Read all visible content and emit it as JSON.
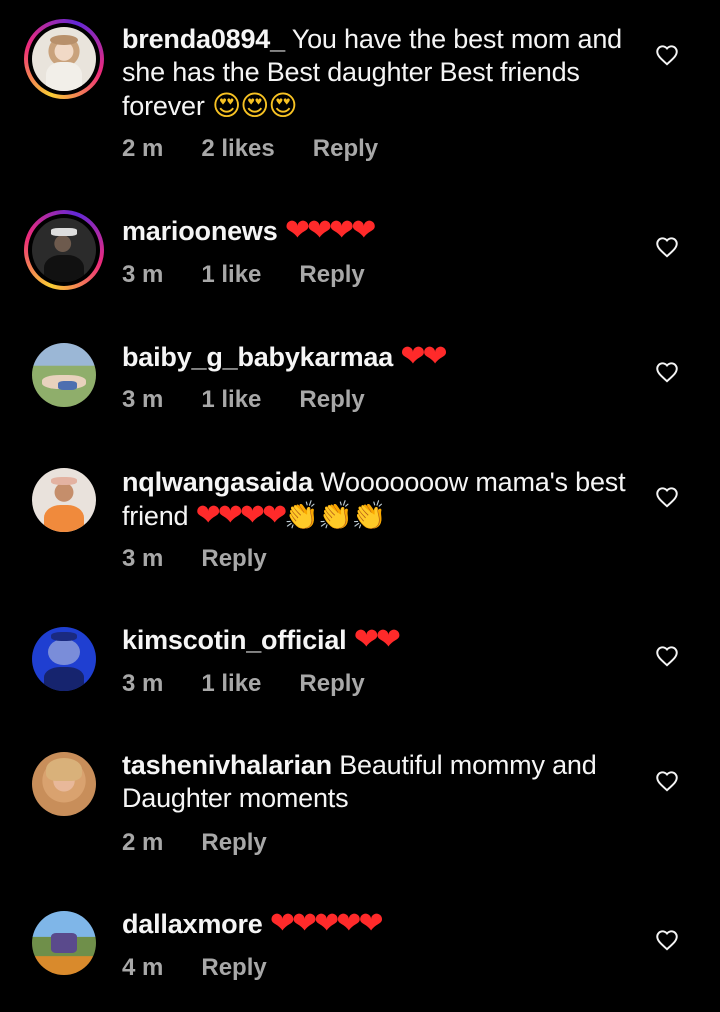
{
  "colors": {
    "background": "#000000",
    "text": "#f5f5f5",
    "meta": "#a8a8a8",
    "heart_emoji": "#ff2a2a",
    "story_ring": "#ee2a7b"
  },
  "comments": [
    {
      "username": "brenda0894_",
      "text": "You have the best mom and she has the Best daughter Best friends forever",
      "emoji": "😍😍😍",
      "time": "2 m",
      "likes": "2 likes",
      "reply": "Reply",
      "story_ring": true,
      "avatar_icon": "woman-avatar",
      "like_icon": "heart-outline-icon"
    },
    {
      "username": "marioonews",
      "text": "",
      "emoji": "❤❤❤❤",
      "time": "3 m",
      "likes": "1 like",
      "reply": "Reply",
      "story_ring": true,
      "avatar_icon": "man-avatar",
      "like_icon": "heart-outline-icon"
    },
    {
      "username": "baiby_g_babykarmaa",
      "text": "",
      "emoji": "❤❤",
      "time": "3 m",
      "likes": "1 like",
      "reply": "Reply",
      "story_ring": false,
      "avatar_icon": "outdoor-avatar",
      "like_icon": "heart-outline-icon"
    },
    {
      "username": "nqlwangasaida",
      "text": "Wooooooow mama's best friend",
      "emoji": "❤❤❤❤",
      "emoji_extra": "👏👏👏",
      "time": "3 m",
      "likes": "",
      "reply": "Reply",
      "story_ring": false,
      "avatar_icon": "person-avatar",
      "like_icon": "heart-outline-icon"
    },
    {
      "username": "kimscotin_official",
      "text": "",
      "emoji": "❤❤",
      "time": "3 m",
      "likes": "1 like",
      "reply": "Reply",
      "story_ring": false,
      "avatar_icon": "cartoon-avatar",
      "like_icon": "heart-outline-icon"
    },
    {
      "username": "tashenivhalarian",
      "text": "Beautiful mommy and Daughter moments",
      "emoji": "",
      "time": "2 m",
      "likes": "",
      "reply": "Reply",
      "story_ring": false,
      "avatar_icon": "woman-avatar",
      "like_icon": "heart-outline-icon"
    },
    {
      "username": "dallaxmore",
      "text": "",
      "emoji": "❤❤❤❤❤",
      "time": "4 m",
      "likes": "",
      "reply": "Reply",
      "story_ring": false,
      "avatar_icon": "landscape-avatar",
      "like_icon": "heart-outline-icon"
    }
  ]
}
